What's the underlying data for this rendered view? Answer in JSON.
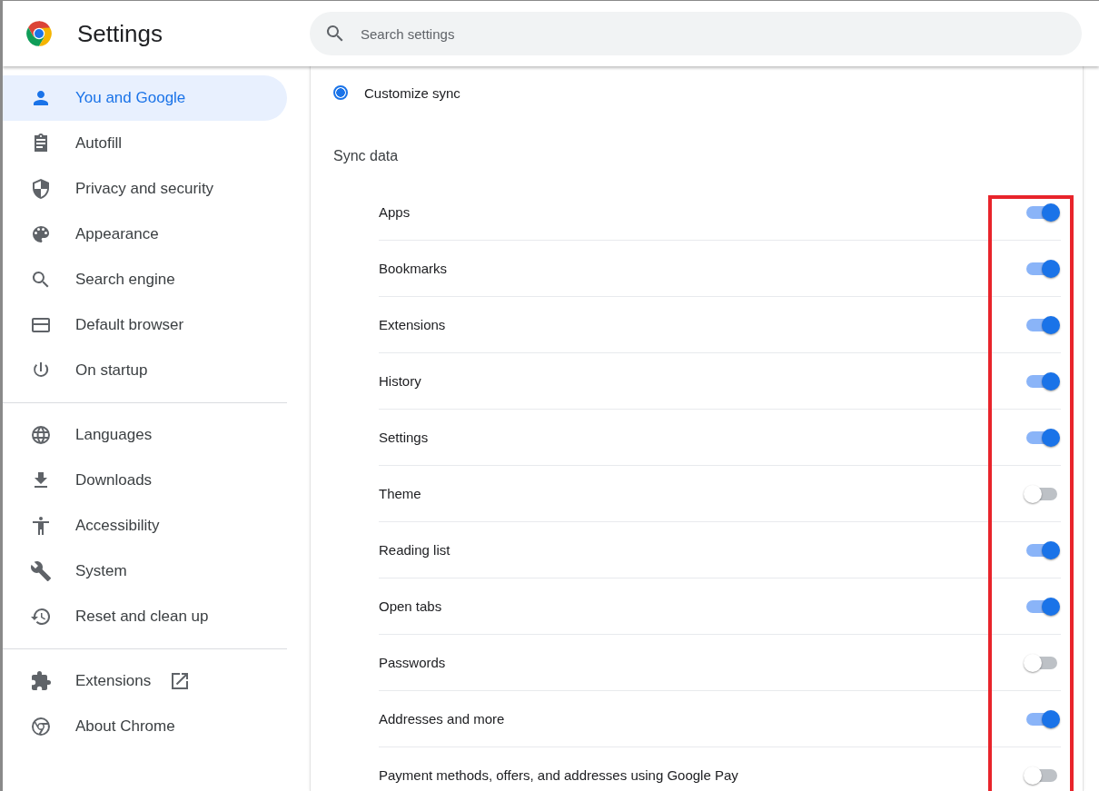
{
  "header": {
    "title": "Settings",
    "search": {
      "placeholder": "Search settings"
    }
  },
  "sidebar": {
    "groups": [
      [
        {
          "label": "You and Google",
          "selected": true,
          "external": false
        },
        {
          "label": "Autofill",
          "selected": false,
          "external": false
        },
        {
          "label": "Privacy and security",
          "selected": false,
          "external": false
        },
        {
          "label": "Appearance",
          "selected": false,
          "external": false
        },
        {
          "label": "Search engine",
          "selected": false,
          "external": false
        },
        {
          "label": "Default browser",
          "selected": false,
          "external": false
        },
        {
          "label": "On startup",
          "selected": false,
          "external": false
        }
      ],
      [
        {
          "label": "Languages",
          "selected": false,
          "external": false
        },
        {
          "label": "Downloads",
          "selected": false,
          "external": false
        },
        {
          "label": "Accessibility",
          "selected": false,
          "external": false
        },
        {
          "label": "System",
          "selected": false,
          "external": false
        },
        {
          "label": "Reset and clean up",
          "selected": false,
          "external": false
        }
      ],
      [
        {
          "label": "Extensions",
          "selected": false,
          "external": true
        },
        {
          "label": "About Chrome",
          "selected": false,
          "external": false
        }
      ]
    ]
  },
  "content": {
    "radio": {
      "label": "Customize sync",
      "selected": true
    },
    "section_title": "Sync data",
    "toggles": [
      {
        "label": "Apps",
        "on": true
      },
      {
        "label": "Bookmarks",
        "on": true
      },
      {
        "label": "Extensions",
        "on": true
      },
      {
        "label": "History",
        "on": true
      },
      {
        "label": "Settings",
        "on": true
      },
      {
        "label": "Theme",
        "on": false
      },
      {
        "label": "Reading list",
        "on": true
      },
      {
        "label": "Open tabs",
        "on": true
      },
      {
        "label": "Passwords",
        "on": false
      },
      {
        "label": "Addresses and more",
        "on": true
      },
      {
        "label": "Payment methods, offers, and addresses using Google Pay",
        "on": false
      }
    ]
  }
}
